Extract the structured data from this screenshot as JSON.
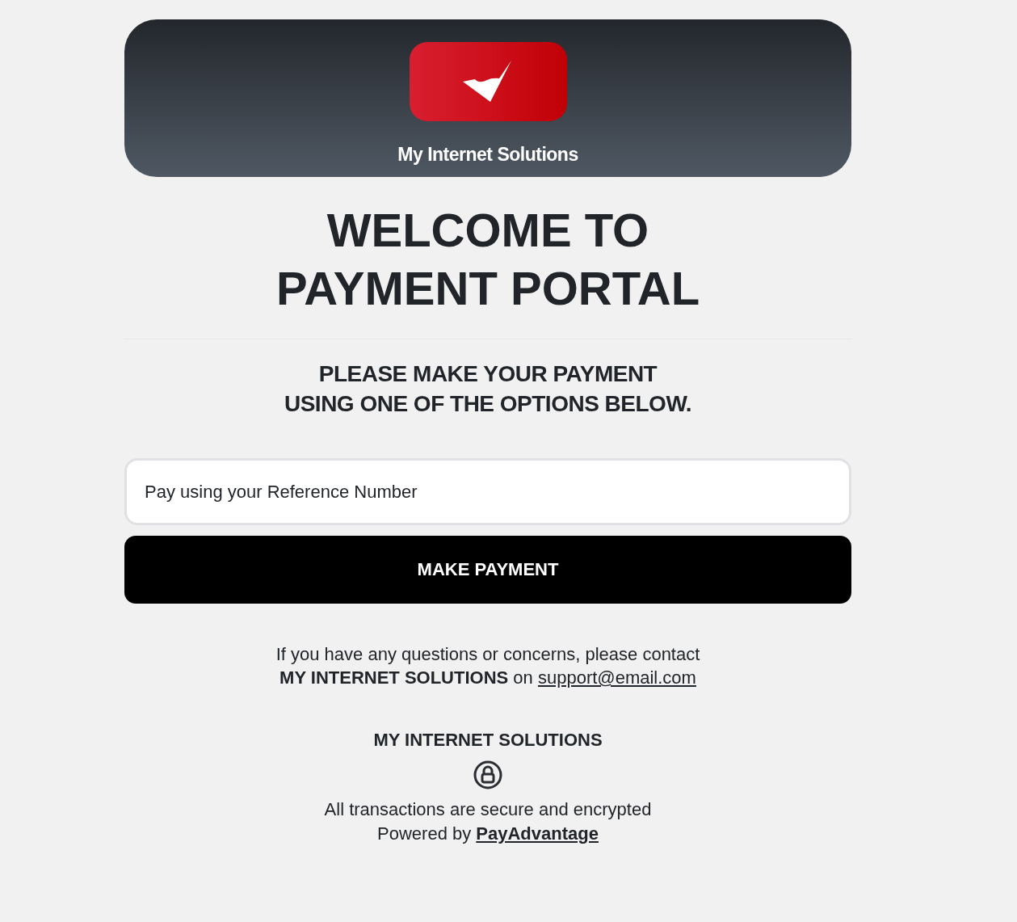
{
  "header": {
    "brand": "My Internet Solutions"
  },
  "title": [
    "WELCOME TO",
    "PAYMENT PORTAL"
  ],
  "subtitle": [
    "PLEASE MAKE YOUR PAYMENT",
    "USING ONE OF THE OPTIONS BELOW."
  ],
  "reference_field": {
    "placeholder": "Pay using your Reference Number"
  },
  "pay_button": {
    "label": "MAKE PAYMENT"
  },
  "contact": {
    "text": "If you have any questions or concerns, please contact\n**MY INTERNET SOLUTIONS** on",
    "link": "support@email.com"
  },
  "footer": {
    "company": "MY INTERNET SOLUTIONS",
    "security_note": "All transactions are secure and encrypted",
    "powered_by": "Powered by",
    "provider_link": "PayAdvantage"
  }
}
